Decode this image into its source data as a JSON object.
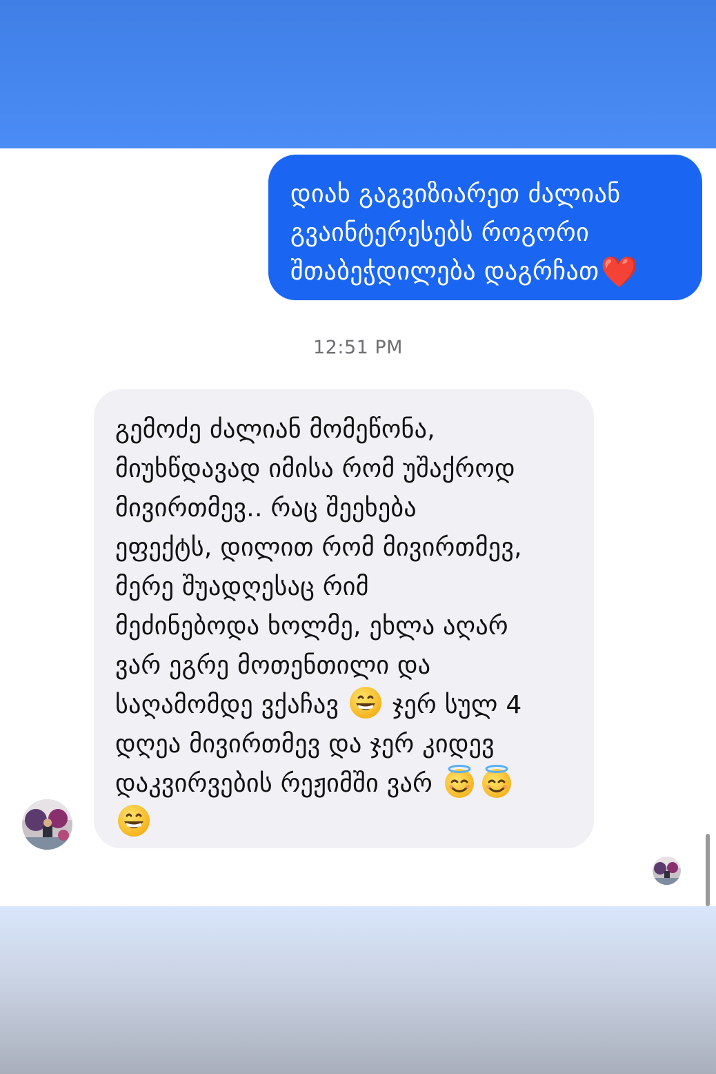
{
  "colors": {
    "header_blue": "#4a8cf5",
    "outgoing_bubble": "#1a66f2",
    "incoming_bubble": "#f0f0f5",
    "heart": "#e0262e"
  },
  "outgoing_message": {
    "lines": [
      "დიახ გაგვიზიარეთ ძალიან",
      "გვაინტერესებს როგორი",
      "შთაბეჭდილება დაგრჩათ"
    ],
    "emoji": "❤️"
  },
  "timestamp": "12:51 PM",
  "incoming_message": {
    "lines": [
      "გემოძე ძალიან მომეწონა,",
      "მიუხწდავად იმისა რომ უშაქროდ",
      "მივირთმევ.. რაც შეეხება",
      "ეფექტს, დილით რომ მივირთმევ,",
      "მერე შუადღესაც რიმ",
      "მეძინებოდა ხოლმე, ეხლა აღარ",
      "ვარ ეგრე მოთენთილი და",
      "საღამომდე ვქაჩავ",
      "ჯერ სულ 4",
      "დღეა მივირთმევ და ჯერ კიდევ",
      "დაკვირვების რეჟიმში ვარ"
    ],
    "emojis": [
      "grinning-face",
      "grinning-face",
      "smiling-face-with-halo",
      "smiling-face-with-halo",
      "grinning-face"
    ]
  },
  "icons": {
    "sender_avatar": "avatar-photo-icon",
    "seen_avatar": "seen-avatar-icon"
  }
}
